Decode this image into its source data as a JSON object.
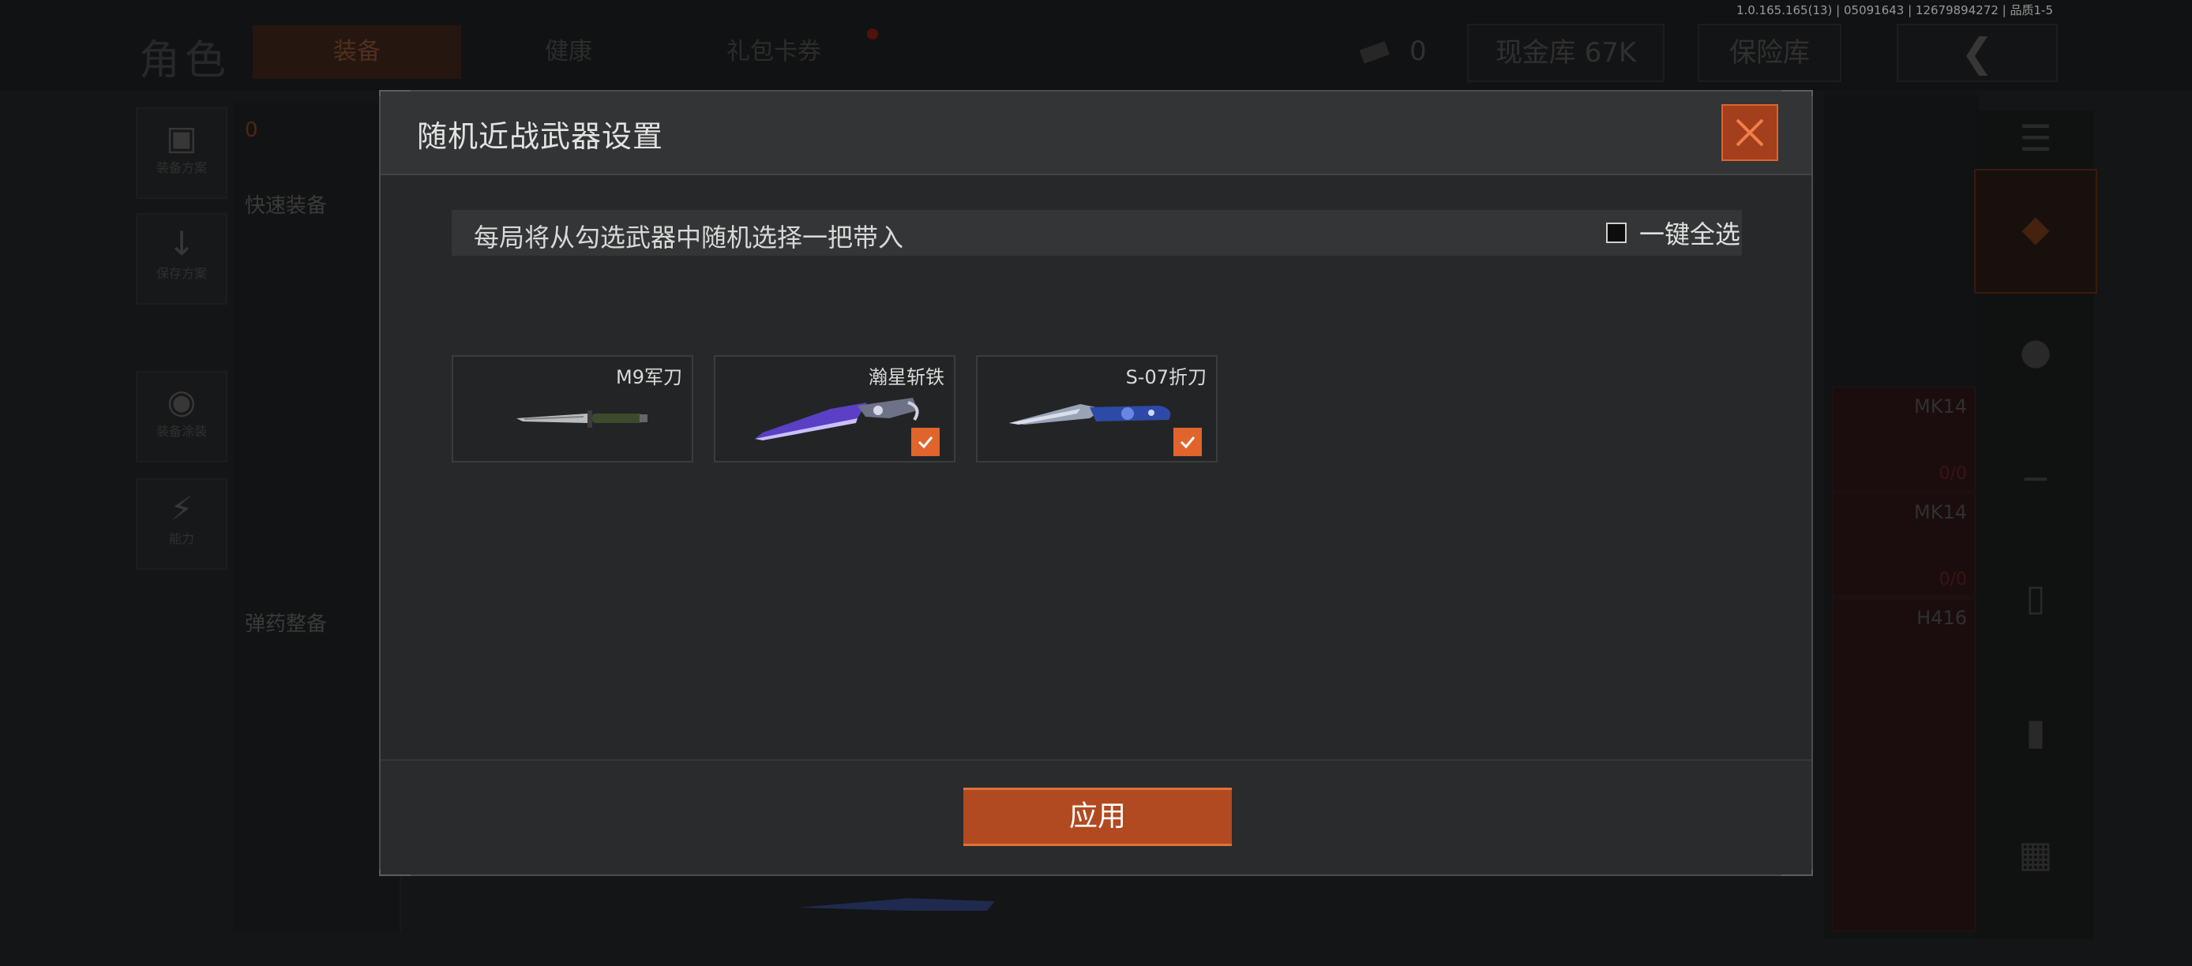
{
  "version": "1.0.165.165(13) | 05091643 | 12679894272 | 品质1-5",
  "background": {
    "role_title": "角色",
    "tabs": [
      {
        "label": "装备"
      },
      {
        "label": "健康"
      },
      {
        "label": "礼包卡券"
      }
    ],
    "cash_count": "0",
    "vault_label": "现金库 67K",
    "safe_label": "保险库",
    "left_buttons": [
      {
        "label": "装备方案"
      },
      {
        "label": "保存方案"
      },
      {
        "label": "装备涂装"
      },
      {
        "label": "能力"
      }
    ],
    "left_panel": {
      "armor_count": "0",
      "quick_equip": "快速装备",
      "ammo": "弹药整备"
    },
    "weapon_slots": [
      {
        "name": "MK14",
        "ammo": "0/0"
      },
      {
        "name": "MK14",
        "ammo": "0/0"
      },
      {
        "name": "H416",
        "ammo": ""
      }
    ]
  },
  "modal": {
    "title": "随机近战武器设置",
    "info_text": "每局将从勾选武器中随机选择一把带入",
    "select_all_label": "一键全选",
    "select_all_checked": false,
    "weapons": [
      {
        "name": "M9军刀",
        "checked": false,
        "icon": "combat-knife-icon"
      },
      {
        "name": "瀚星斩铁",
        "checked": true,
        "icon": "cleaver-knife-icon"
      },
      {
        "name": "S-07折刀",
        "checked": true,
        "icon": "folding-knife-icon"
      }
    ],
    "apply_label": "应用"
  },
  "colors": {
    "accent": "#e0642c",
    "button": "#b14a20"
  }
}
